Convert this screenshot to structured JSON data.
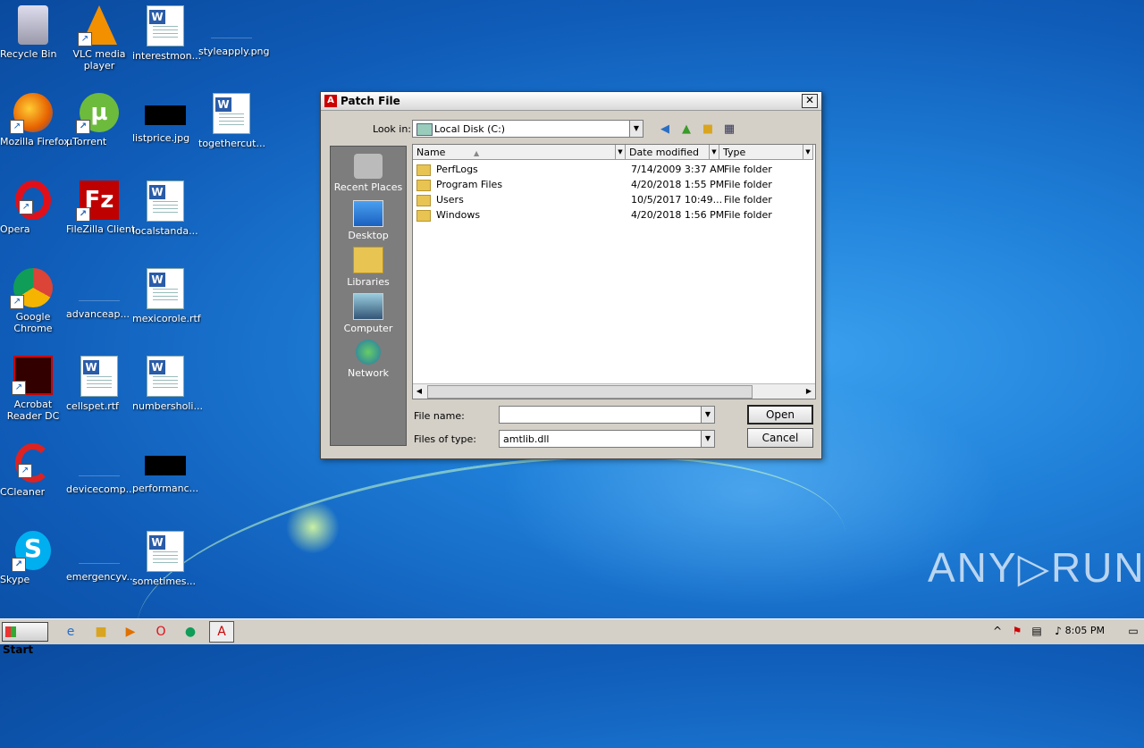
{
  "desktop": {
    "icons": [
      {
        "label": "Recycle Bin"
      },
      {
        "label": "VLC media player"
      },
      {
        "label": "interestmon..."
      },
      {
        "label": "styleapply.png"
      },
      {
        "label": "Mozilla Firefox"
      },
      {
        "label": "µTorrent"
      },
      {
        "label": "listprice.jpg"
      },
      {
        "label": "togethercut..."
      },
      {
        "label": "Opera"
      },
      {
        "label": "FileZilla Client"
      },
      {
        "label": "localstanda..."
      },
      {
        "label": "Google Chrome"
      },
      {
        "label": "advanceap..."
      },
      {
        "label": "mexicorole.rtf"
      },
      {
        "label": "Acrobat Reader DC"
      },
      {
        "label": "cellspet.rtf"
      },
      {
        "label": "numbersholi..."
      },
      {
        "label": "CCleaner"
      },
      {
        "label": "devicecomp..."
      },
      {
        "label": "performanc..."
      },
      {
        "label": "Skype"
      },
      {
        "label": "emergencyv..."
      },
      {
        "label": "sometimes..."
      }
    ]
  },
  "dialog": {
    "title": "Patch File",
    "close_glyph": "✕",
    "look_in_label": "Look in:",
    "look_in_value": "Local Disk (C:)",
    "places": [
      {
        "label": "Recent Places"
      },
      {
        "label": "Desktop"
      },
      {
        "label": "Libraries"
      },
      {
        "label": "Computer"
      },
      {
        "label": "Network"
      }
    ],
    "columns": [
      "Name",
      "Date modified",
      "Type"
    ],
    "files": [
      {
        "name": "PerfLogs",
        "date": "7/14/2009 3:37 AM",
        "type": "File folder"
      },
      {
        "name": "Program Files",
        "date": "4/20/2018 1:55 PM",
        "type": "File folder"
      },
      {
        "name": "Users",
        "date": "10/5/2017 10:49...",
        "type": "File folder"
      },
      {
        "name": "Windows",
        "date": "4/20/2018 1:56 PM",
        "type": "File folder"
      }
    ],
    "file_name_label": "File name:",
    "file_name_value": "",
    "files_of_type_label": "Files of type:",
    "files_of_type_value": "amtlib.dll",
    "open_label": "Open",
    "cancel_label": "Cancel"
  },
  "taskbar": {
    "start_label": "Start",
    "clock": "8:05 PM"
  },
  "watermark": "ANY▷RUN"
}
